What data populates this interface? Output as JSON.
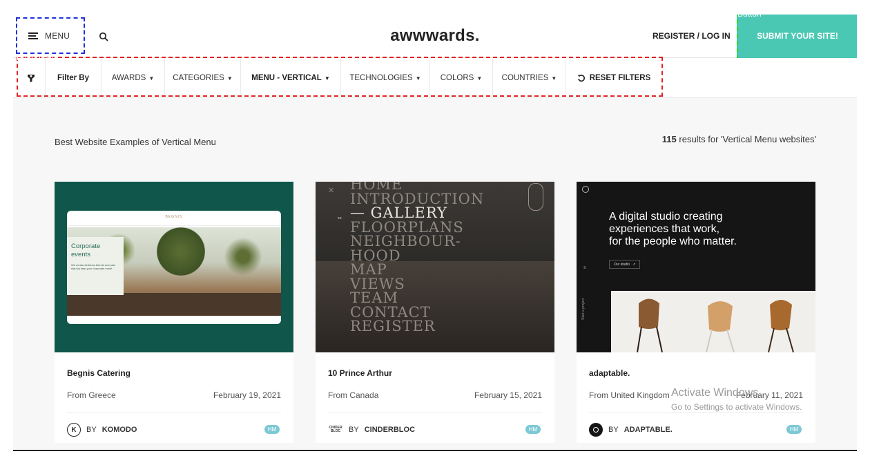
{
  "annotations": {
    "menu_tag": "Button",
    "submit_tag": "Button",
    "filter_tag": "Button Box"
  },
  "header": {
    "menu_label": "MENU",
    "logo": "awwwards.",
    "login_label": "REGISTER / LOG IN",
    "submit_label": "SUBMIT YOUR SITE!"
  },
  "filters": {
    "filter_by": "Filter By",
    "items": [
      "AWARDS",
      "CATEGORIES",
      "MENU - VERTICAL",
      "TECHNOLOGIES",
      "COLORS",
      "COUNTRIES"
    ],
    "reset": "RESET FILTERS"
  },
  "listing": {
    "title": "Best Website Examples of Vertical Menu",
    "results_count": "115",
    "results_text": " results for 'Vertical Menu websites'"
  },
  "cards": [
    {
      "name": "Begnis Catering",
      "from": "From Greece",
      "date": "February 19, 2021",
      "by": "BY",
      "author": "KOMODO",
      "avatar": "K",
      "badge": "HM",
      "thumb": {
        "heading": "Corporate events",
        "text": "We create delicious blends and plan step by step your corporate event",
        "brand": "BEGNIS"
      }
    },
    {
      "name": "10 Prince Arthur",
      "from": "From Canada",
      "date": "February 15, 2021",
      "by": "BY",
      "author": "CINDERBLOC",
      "avatar": "CINDER BLOC",
      "badge": "HM",
      "thumb": {
        "menu": [
          "HOME",
          "INTRODUCTION",
          "GALLERY",
          "FLOORPLANS",
          "NEIGHBOUR-",
          "HOOD",
          "MAP",
          "VIEWS",
          "TEAM",
          "CONTACT",
          "REGISTER"
        ]
      }
    },
    {
      "name": "adaptable.",
      "from": "From United Kingdom",
      "date": "February 11, 2021",
      "by": "BY",
      "author": "ADAPTABLE.",
      "avatar": "",
      "badge": "HM",
      "thumb": {
        "headline": [
          "A digital studio creating",
          "experiences that work,",
          "for the people who matter."
        ],
        "cta": "Our studio",
        "side": "Start a project"
      }
    }
  ],
  "watermark": {
    "line1": "Activate Windows",
    "line2": "Go to Settings to activate Windows."
  },
  "colors": {
    "accent": "#4bc8b4",
    "card1_bg": "#10564a",
    "card2_bg": "#2a2826",
    "card3_bg": "#151515"
  }
}
